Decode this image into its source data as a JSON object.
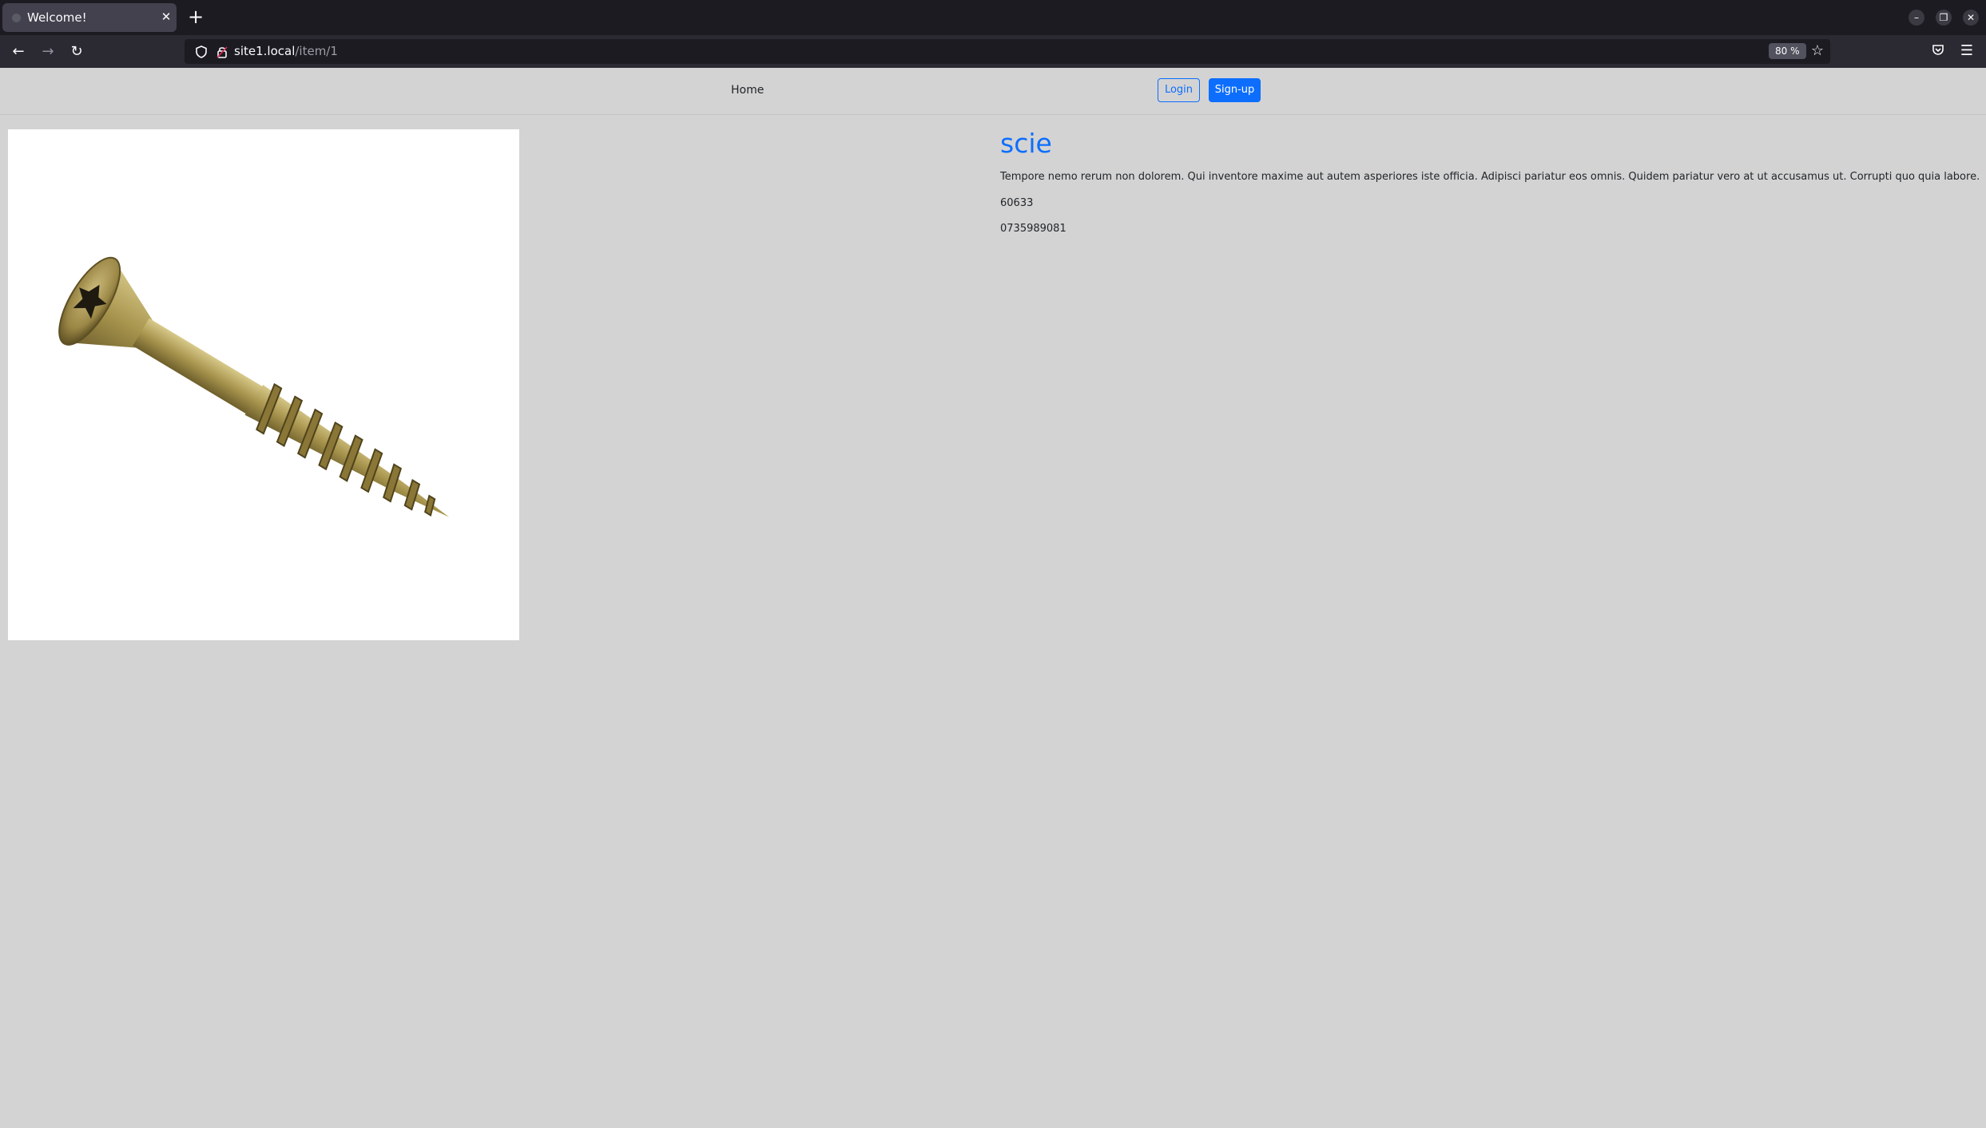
{
  "browser": {
    "tab_title": "Welcome!",
    "url_host": "site1.local",
    "url_path": "/item/1",
    "zoom": "80 %"
  },
  "header": {
    "home_label": "Home",
    "login_label": "Login",
    "signup_label": "Sign-up"
  },
  "product": {
    "title": "scie",
    "description": "Tempore nemo rerum non dolorem. Qui inventore maxime aut autem asperiores iste officia. Adipisci pariatur eos omnis. Quidem pariatur vero at ut accusamus ut. Corrupti quo quia labore.",
    "code": "60633",
    "phone": "0735989081"
  },
  "colors": {
    "accent": "#0d6efd",
    "page_background": "#d3d3d3"
  }
}
